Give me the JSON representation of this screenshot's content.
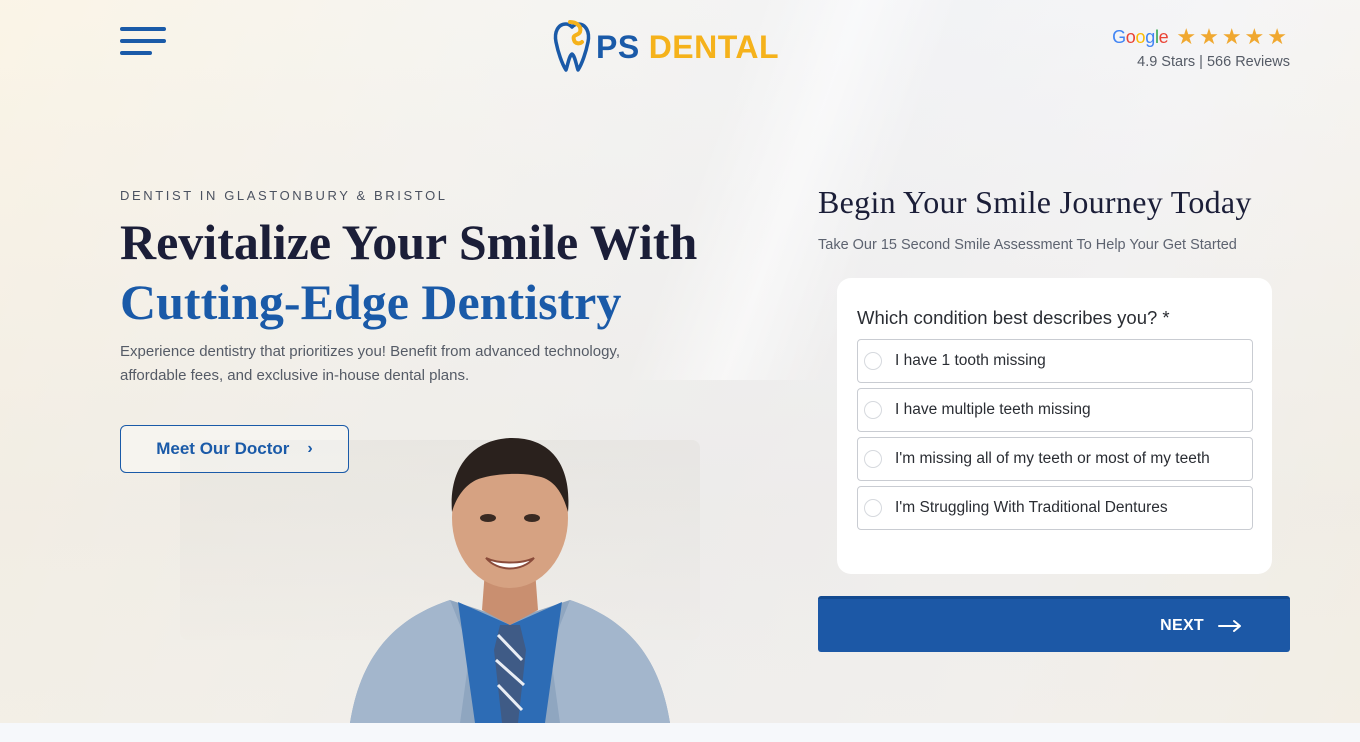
{
  "header": {
    "menu_icon": "hamburger-menu-icon",
    "logo": {
      "part1": "PS",
      "part2": "DENTAL",
      "icon": "tooth-logo-icon"
    },
    "reviews": {
      "google_letters": [
        "G",
        "o",
        "o",
        "g",
        "l",
        "e"
      ],
      "stars": "★★★★★",
      "rating_text": "4.9 Stars | 566 Reviews"
    }
  },
  "hero": {
    "eyebrow": "DENTIST IN GLASTONBURY & BRISTOL",
    "headline_line1": "Revitalize Your Smile With",
    "headline_line2": "Cutting-Edge Dentistry",
    "intro_line1": "Experience dentistry that prioritizes you! Benefit from advanced technology,",
    "intro_line2": "affordable fees, and exclusive in-house dental plans.",
    "doctor_button": "Meet Our Doctor",
    "doctor_button_icon": "chevron-right-icon"
  },
  "form": {
    "title": "Begin Your Smile Journey Today",
    "subtitle": "Take Our 15 Second Smile Assessment To Help Your Get Started",
    "question": "Which condition best describes you? *",
    "options": [
      "I have 1 tooth missing",
      "I have multiple teeth missing",
      "I'm missing all of my teeth or most of my teeth",
      "I'm Struggling With Traditional Dentures"
    ],
    "next_label": "NEXT",
    "next_icon": "arrow-right-icon"
  },
  "colors": {
    "brand_blue": "#1a5aa8",
    "brand_yellow": "#f5b21b",
    "button_blue": "#1c58a6",
    "star_gold": "#f0a830"
  }
}
